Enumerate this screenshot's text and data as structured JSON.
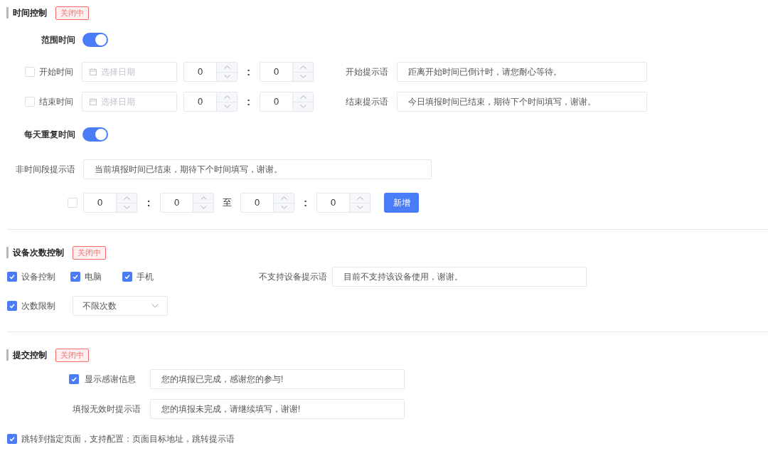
{
  "time_control": {
    "title": "时间控制",
    "status_badge": "关闭中",
    "range_time": {
      "label": "范围时间",
      "on": true
    },
    "range_rows": [
      {
        "checked": false,
        "label": "开始时间",
        "date_placeholder": "选择日期",
        "hour": "0",
        "colon": ":",
        "minute": "0",
        "hint_label": "开始提示语",
        "hint_value": "距离开始时间已倒计时，请您耐心等待。"
      },
      {
        "checked": false,
        "label": "结束时间",
        "date_placeholder": "选择日期",
        "hour": "0",
        "colon": ":",
        "minute": "0",
        "hint_label": "结束提示语",
        "hint_value": "今日填报时间已结束，期待下个时间填写，谢谢。"
      }
    ],
    "daily_repeat": {
      "label": "每天重复时间",
      "on": true
    },
    "off_period_hint": {
      "label": "非时间段提示语",
      "value": "当前填报时间已结束，期待下个时间填写，谢谢。"
    },
    "period_row": {
      "checked": false,
      "times": [
        {
          "hour": "0",
          "colon": ":",
          "minute": "0"
        },
        {
          "hour": "0",
          "colon": ":",
          "minute": "0"
        }
      ],
      "separator": "至",
      "add_button": "新增"
    }
  },
  "device_control": {
    "title": "设备次数控制",
    "status_badge": "关闭中",
    "devices": [
      {
        "label": "设备控制",
        "checked": true
      },
      {
        "label": "电脑",
        "checked": true
      },
      {
        "label": "手机",
        "checked": true
      }
    ],
    "unsupported_hint": {
      "label": "不支持设备提示语",
      "value": "目前不支持该设备使用，谢谢。"
    },
    "count_limit": {
      "label": "次数限制",
      "checked": true,
      "select_value": "不限次数"
    }
  },
  "submit_control": {
    "title": "提交控制",
    "status_badge": "关闭中",
    "thanks": {
      "label": "显示感谢信息",
      "checked": true,
      "value": "您的填报已完成，感谢您的参与!"
    },
    "invalid_hint": {
      "label": "填报无效时提示语",
      "value": "您的填报未完成，请继续填写，谢谢!"
    },
    "redirect": {
      "label": "跳转到指定页面，支持配置：页面目标地址，跳转提示语",
      "checked": true
    }
  }
}
